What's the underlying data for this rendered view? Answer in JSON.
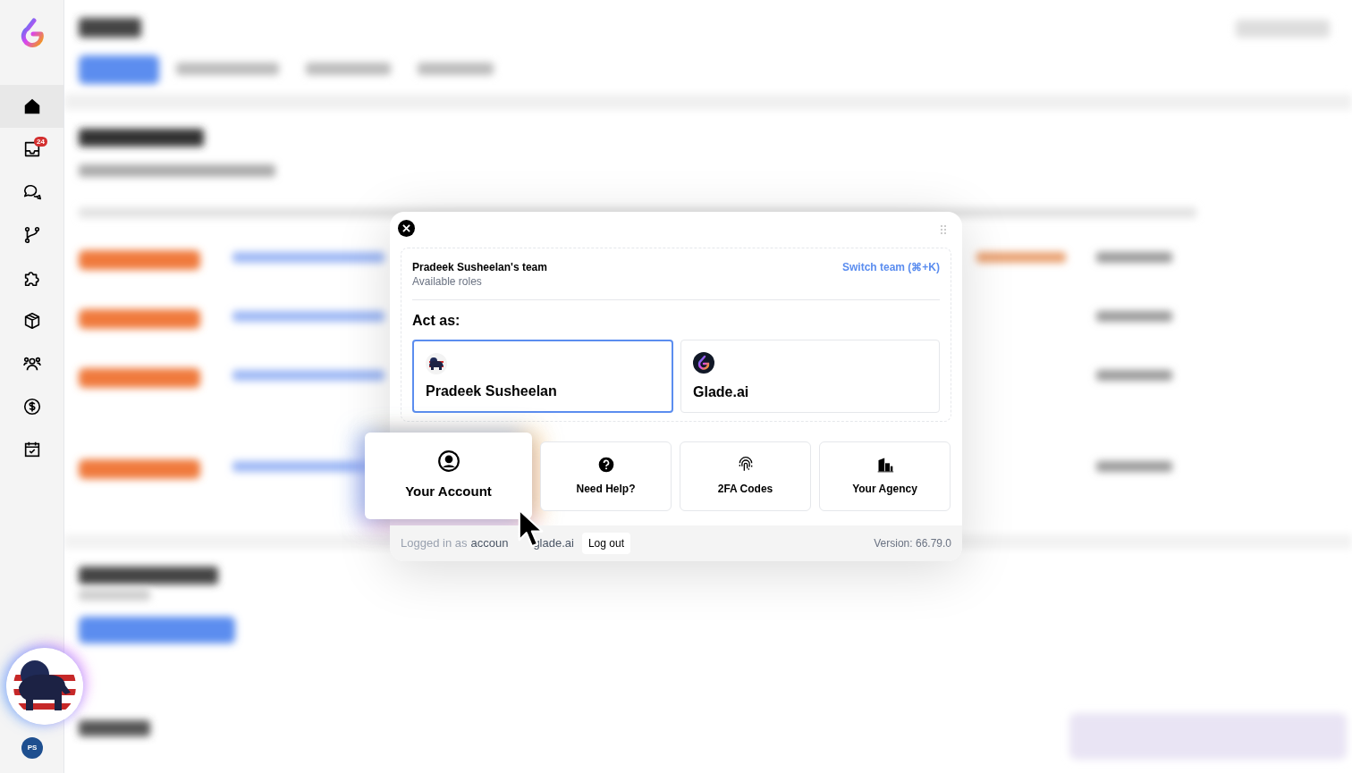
{
  "sidebar": {
    "items": [
      {
        "kind": "home",
        "selected": true
      },
      {
        "kind": "inbox",
        "selected": false,
        "badge": "24"
      },
      {
        "kind": "chat",
        "selected": false
      },
      {
        "kind": "branch",
        "selected": false
      },
      {
        "kind": "puzzle",
        "selected": false
      },
      {
        "kind": "box",
        "selected": false
      },
      {
        "kind": "people",
        "selected": false
      },
      {
        "kind": "dollar",
        "selected": false
      },
      {
        "kind": "calendar",
        "selected": false
      }
    ],
    "user_initials": "PS"
  },
  "dialog": {
    "team_name": "Pradeek Susheelan's team",
    "subtitle": "Available roles",
    "switch_team": "Switch team (⌘+K)",
    "act_as_label": "Act as:",
    "roles": [
      {
        "name": "Pradeek Susheelan",
        "kind": "person",
        "selected": true
      },
      {
        "name": "Glade.ai",
        "kind": "company",
        "selected": false
      }
    ],
    "tiles": [
      {
        "label": "Your Account",
        "kind": "account",
        "hovered": true
      },
      {
        "label": "Need Help?",
        "kind": "help",
        "hovered": false
      },
      {
        "label": "2FA Codes",
        "kind": "fingerprint",
        "hovered": false
      },
      {
        "label": "Your Agency",
        "kind": "building",
        "hovered": false
      }
    ],
    "logged_in_prefix": "Logged in as",
    "account_parts": [
      "accoun",
      "glade.ai"
    ],
    "logout": "Log out",
    "version": "Version: 66.79.0"
  }
}
